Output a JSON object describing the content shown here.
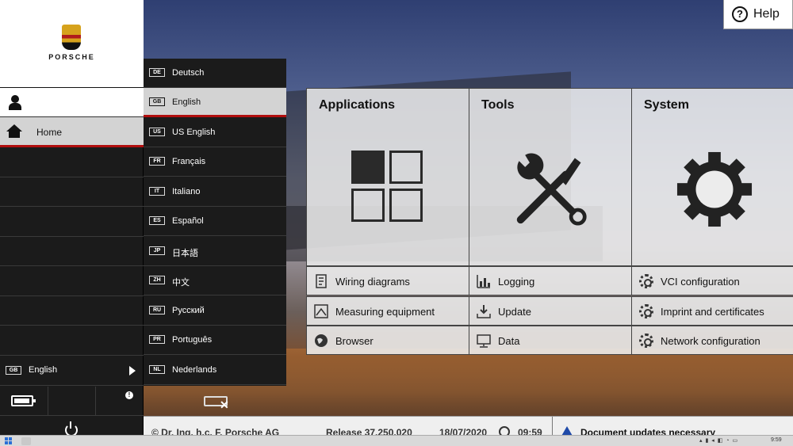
{
  "brand": {
    "wordmark": "PORSCHE"
  },
  "sidebar": {
    "home_label": "Home",
    "current_language": {
      "code": "GB",
      "label": "English"
    },
    "status_info_mark": "!"
  },
  "languages": [
    {
      "code": "DE",
      "label": "Deutsch"
    },
    {
      "code": "GB",
      "label": "English"
    },
    {
      "code": "US",
      "label": "US English"
    },
    {
      "code": "FR",
      "label": "Français"
    },
    {
      "code": "IT",
      "label": "Italiano"
    },
    {
      "code": "ES",
      "label": "Español"
    },
    {
      "code": "JP",
      "label": "日本語"
    },
    {
      "code": "ZH",
      "label": "中文"
    },
    {
      "code": "RU",
      "label": "Русский"
    },
    {
      "code": "PR",
      "label": "Português"
    },
    {
      "code": "NL",
      "label": "Nederlands"
    }
  ],
  "selected_language_code": "GB",
  "help": {
    "label": "Help",
    "icon": "question-circle-icon"
  },
  "tiles": {
    "applications": {
      "title": "Applications",
      "links": [
        {
          "label": "Wiring diagrams",
          "icon": "wiring-diagram-icon"
        },
        {
          "label": "Measuring equipment",
          "icon": "measuring-equipment-icon"
        },
        {
          "label": "Browser",
          "icon": "globe-icon"
        }
      ]
    },
    "tools": {
      "title": "Tools",
      "links": [
        {
          "label": "Logging",
          "icon": "bar-chart-icon"
        },
        {
          "label": "Update",
          "icon": "download-tray-icon"
        },
        {
          "label": "Data",
          "icon": "monitor-icon"
        }
      ]
    },
    "system": {
      "title": "System",
      "links": [
        {
          "label": "VCI configuration",
          "icon": "gear-icon"
        },
        {
          "label": "Imprint and certificates",
          "icon": "gear-icon"
        },
        {
          "label": "Network configuration",
          "icon": "gear-icon"
        }
      ]
    }
  },
  "footer": {
    "copyright": "© Dr. Ing. h.c. F. Porsche AG",
    "release": "Release 37.250.020",
    "date": "18/07/2020",
    "time": "09:59",
    "notice": "Document updates necessary"
  },
  "taskbar": {
    "time": "9:59"
  },
  "colors": {
    "accent_red": "#b10e0e",
    "sidebar_bg": "#1b1b1b",
    "warning_blue": "#1f4aa8"
  }
}
